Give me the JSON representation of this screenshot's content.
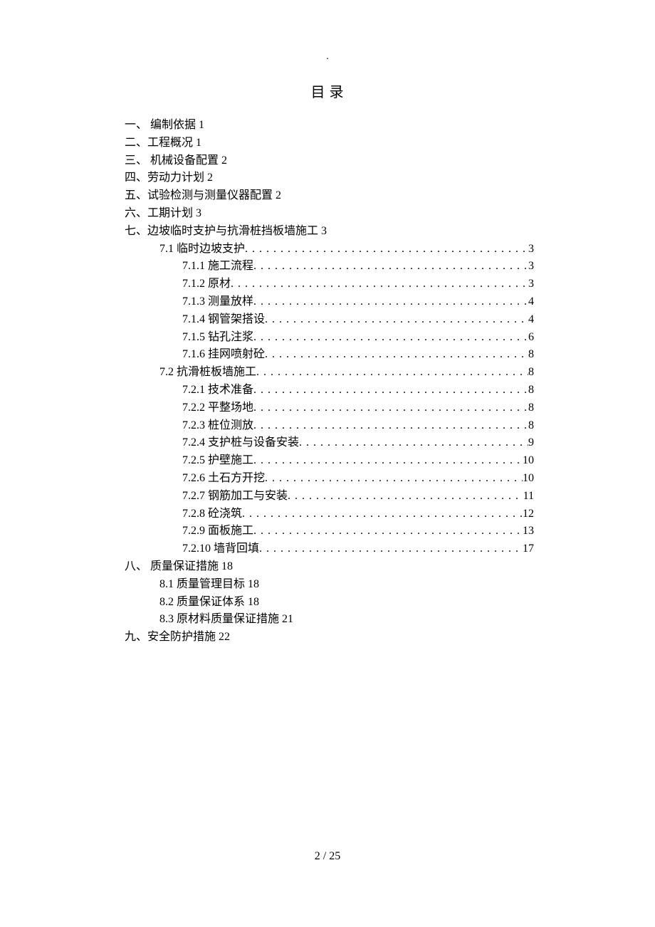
{
  "title": "目录",
  "top_marker": ".",
  "footer": "2 / 25",
  "entries": [
    {
      "indent": 0,
      "text": "一、 编制依据 1",
      "leader": false
    },
    {
      "indent": 0,
      "text": "二、工程概况 1",
      "leader": false
    },
    {
      "indent": 0,
      "text": "三、 机械设备配置 2",
      "leader": false
    },
    {
      "indent": 0,
      "text": "四、劳动力计划 2",
      "leader": false
    },
    {
      "indent": 0,
      "text": "五、试验检测与测量仪器配置 2",
      "leader": false
    },
    {
      "indent": 0,
      "text": "六、工期计划 3",
      "leader": false
    },
    {
      "indent": 0,
      "text": "七、边坡临时支护与抗滑桩挡板墙施工 3",
      "leader": false
    },
    {
      "indent": 1,
      "text": "7.1 临时边坡支护",
      "leader": true,
      "page": "3"
    },
    {
      "indent": 2,
      "text": "7.1.1 施工流程",
      "leader": true,
      "page": "3"
    },
    {
      "indent": 2,
      "text": "7.1.2 原材",
      "leader": true,
      "page": "3"
    },
    {
      "indent": 2,
      "text": "7.1.3 测量放样",
      "leader": true,
      "page": "4"
    },
    {
      "indent": 2,
      "text": "7.1.4 钢管架搭设",
      "leader": true,
      "page": "4"
    },
    {
      "indent": 2,
      "text": "7.1.5 钻孔注浆",
      "leader": true,
      "page": "6"
    },
    {
      "indent": 2,
      "text": "7.1.6 挂网喷射砼",
      "leader": true,
      "page": "8"
    },
    {
      "indent": 1,
      "text": "7.2 抗滑桩板墙施工",
      "leader": true,
      "page": "8"
    },
    {
      "indent": 2,
      "text": "7.2.1 技术准备",
      "leader": true,
      "page": "8"
    },
    {
      "indent": 2,
      "text": "7.2.2 平整场地",
      "leader": true,
      "page": "8"
    },
    {
      "indent": 2,
      "text": "7.2.3 桩位测放",
      "leader": true,
      "page": "8"
    },
    {
      "indent": 2,
      "text": "7.2.4 支护桩与设备安装",
      "leader": true,
      "page": "9"
    },
    {
      "indent": 2,
      "text": "7.2.5 护壁施工",
      "leader": true,
      "page": "10"
    },
    {
      "indent": 2,
      "text": "7.2.6 土石方开挖",
      "leader": true,
      "page": "10"
    },
    {
      "indent": 2,
      "text": "7.2.7 钢筋加工与安装",
      "leader": true,
      "page": "11"
    },
    {
      "indent": 2,
      "text": "7.2.8 砼浇筑",
      "leader": true,
      "page": "12"
    },
    {
      "indent": 2,
      "text": "7.2.9 面板施工",
      "leader": true,
      "page": "13"
    },
    {
      "indent": 2,
      "text": "7.2.10 墙背回填",
      "leader": true,
      "page": "17"
    },
    {
      "indent": 0,
      "text": "八、 质量保证措施 18",
      "leader": false
    },
    {
      "indent": 1,
      "text": "8.1 质量管理目标 18",
      "leader": false
    },
    {
      "indent": 1,
      "text": "8.2 质量保证体系 18",
      "leader": false
    },
    {
      "indent": 1,
      "text": "8.3 原材料质量保证措施 21",
      "leader": false
    },
    {
      "indent": 0,
      "text": "九、安全防护措施 22",
      "leader": false
    }
  ]
}
